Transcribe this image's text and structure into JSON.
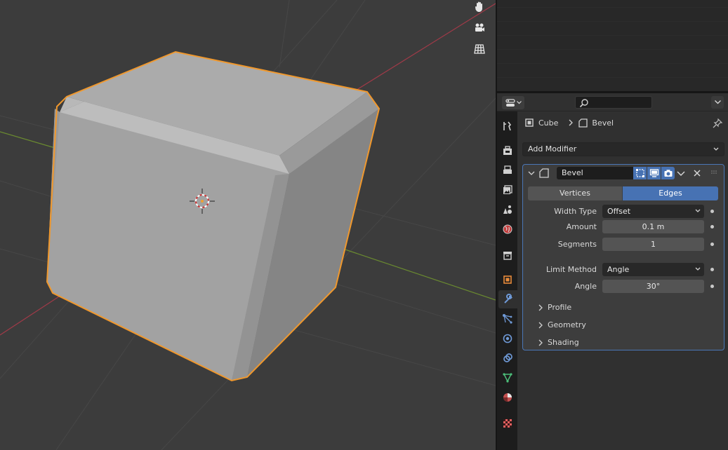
{
  "viewport": {
    "nav_icons": [
      "hand-icon",
      "camera-icon",
      "grid-icon"
    ]
  },
  "properties": {
    "search": {
      "placeholder": ""
    },
    "tabs": [
      "tool-icon",
      "render-icon",
      "output-icon",
      "view-layer-icon",
      "scene-icon",
      "world-icon",
      "collection-icon",
      "object-icon",
      "modifier-icon",
      "particles-icon",
      "physics-icon",
      "constraints-icon",
      "data-icon",
      "material-icon",
      "texture-icon"
    ],
    "active_tab": "modifier-icon",
    "breadcrumb": {
      "object": "Cube",
      "modifier": "Bevel"
    },
    "add_modifier_label": "Add Modifier",
    "modifier": {
      "name": "Bevel",
      "affect_options": [
        "Vertices",
        "Edges"
      ],
      "affect_selected": "Edges",
      "width_type": {
        "label": "Width Type",
        "value": "Offset"
      },
      "amount": {
        "label": "Amount",
        "value": "0.1 m"
      },
      "segments": {
        "label": "Segments",
        "value": "1"
      },
      "limit_method": {
        "label": "Limit Method",
        "value": "Angle"
      },
      "angle": {
        "label": "Angle",
        "value": "30°"
      },
      "subpanels": [
        "Profile",
        "Geometry",
        "Shading"
      ]
    },
    "colors": {
      "accent": "#4772b3",
      "selection_outline": "#f5a030",
      "panel_bg": "#3d3d3d"
    }
  }
}
